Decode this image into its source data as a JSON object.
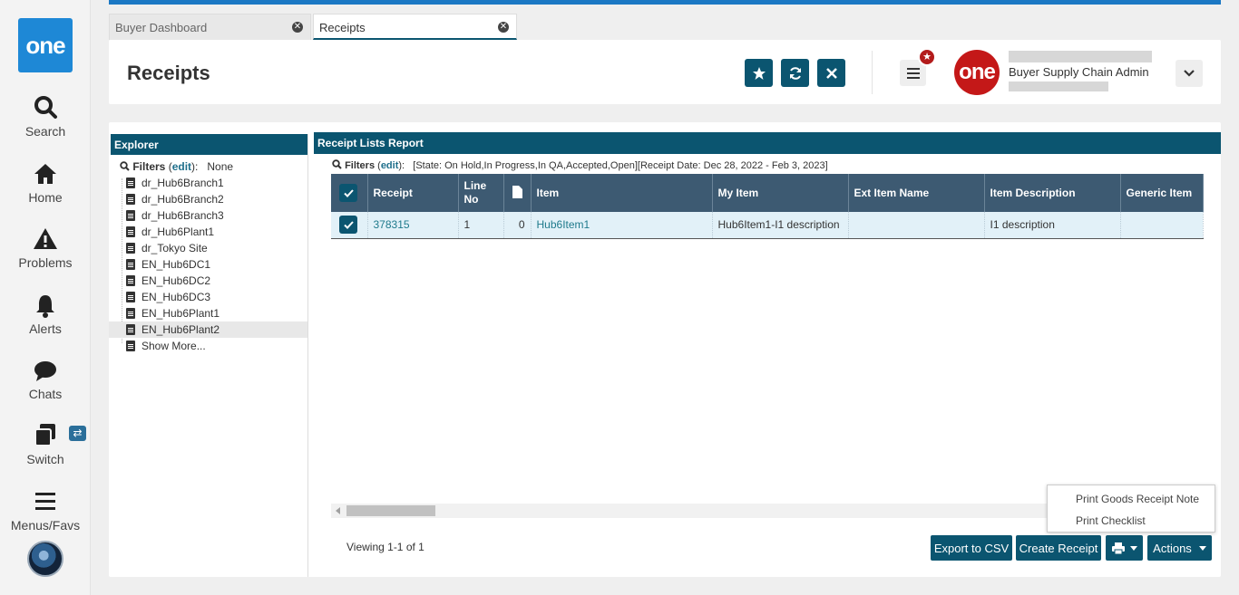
{
  "nav": {
    "logo": "one",
    "items": [
      {
        "label": "Search",
        "icon": "search-icon"
      },
      {
        "label": "Home",
        "icon": "home-icon"
      },
      {
        "label": "Problems",
        "icon": "warning-icon"
      },
      {
        "label": "Alerts",
        "icon": "bell-icon"
      },
      {
        "label": "Chats",
        "icon": "chat-icon"
      },
      {
        "label": "Switch",
        "icon": "switch-icon"
      },
      {
        "label": "Menus/Favs",
        "icon": "hamburger-icon"
      }
    ]
  },
  "tabs": [
    {
      "label": "Buyer Dashboard",
      "active": false
    },
    {
      "label": "Receipts",
      "active": true
    }
  ],
  "header": {
    "title": "Receipts",
    "profile_logo": "one",
    "role": "Buyer Supply Chain Admin"
  },
  "explorer": {
    "title": "Explorer",
    "filters_label": "Filters",
    "edit_label": "edit",
    "filters_value": "None",
    "items": [
      "dr_Hub6Branch1",
      "dr_Hub6Branch2",
      "dr_Hub6Branch3",
      "dr_Hub6Plant1",
      "dr_Tokyo Site",
      "EN_Hub6DC1",
      "EN_Hub6DC2",
      "EN_Hub6DC3",
      "EN_Hub6Plant1",
      "EN_Hub6Plant2",
      "Show More..."
    ],
    "selected": "EN_Hub6Plant2"
  },
  "report": {
    "title": "Receipt Lists Report",
    "filters_label": "Filters",
    "edit_label": "edit",
    "filters_value": "[State: On Hold,In Progress,In QA,Accepted,Open][Receipt Date: Dec 28, 2022 - Feb 3, 2023]",
    "columns": [
      "Receipt",
      "Line No",
      "",
      "Item",
      "My Item",
      "Ext Item Name",
      "Item Description",
      "Generic Item"
    ],
    "rows": [
      {
        "receipt": "378315",
        "line_no": "1",
        "docs": "0",
        "item": "Hub6Item1",
        "my_item": "Hub6Item1-I1 description",
        "ext_item_name": "",
        "item_description": "I1 description",
        "generic_item": ""
      }
    ],
    "viewing": "Viewing 1-1 of 1"
  },
  "buttons": {
    "export_csv": "Export to CSV",
    "create_receipt": "Create Receipt",
    "actions": "Actions"
  },
  "print_menu": [
    "Print Goods Receipt Note",
    "Print Checklist"
  ],
  "colors": {
    "primary": "#0b5570",
    "top_bar": "#1b78c4",
    "table_header": "#3d5a72",
    "row_selected": "#e2f1f8",
    "logo_blue": "#1e88d6",
    "profile_red": "#c41818"
  }
}
